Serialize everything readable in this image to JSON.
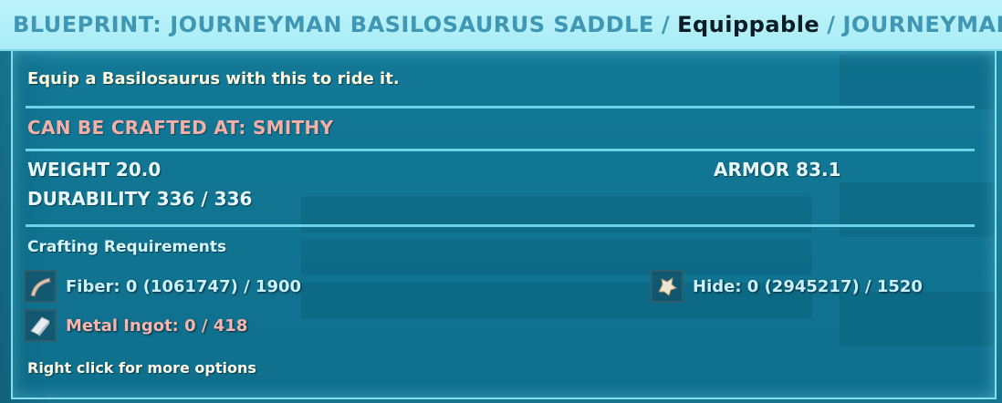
{
  "header": {
    "title": "BLUEPRINT: JOURNEYMAN BASILOSAURUS SADDLE",
    "separator": "/",
    "equippable": "Equippable",
    "quality": "JOURNEYMAN"
  },
  "tooltip": {
    "description": "Equip a Basilosaurus with this to ride it.",
    "crafted_at": "CAN BE CRAFTED AT: SMITHY",
    "weight": "WEIGHT 20.0",
    "armor": "ARMOR 83.1",
    "durability": "DURABILITY 336 / 336",
    "requirements_title": "Crafting Requirements",
    "requirements": [
      {
        "label": "Fiber: 0 (1061747) / 1900",
        "icon": "fiber-icon",
        "status": "ok"
      },
      {
        "label": "Hide: 0 (2945217) / 1520",
        "icon": "hide-icon",
        "status": "ok"
      },
      {
        "label": "Metal Ingot: 0 / 418",
        "icon": "metal-ingot-icon",
        "status": "missing"
      }
    ],
    "hint": "Right click for more options"
  },
  "colors": {
    "header_bg": "#bff3fb",
    "header_text": "#3f97b4",
    "panel_border": "#7fe0f0",
    "crafted_at": "#f4b0a8",
    "missing": "#f6b5ae",
    "ok": "#c8f2ff"
  }
}
